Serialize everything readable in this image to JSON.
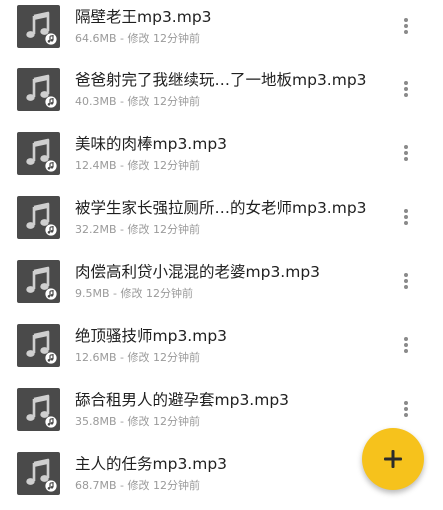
{
  "colors": {
    "thumb_bg": "#4a4a4a",
    "note_color": "#cfcfcf",
    "fab_bg": "#f6c21c",
    "title_color": "#1f1f1f",
    "meta_color": "#9a9a9a"
  },
  "icons": {
    "thumbnail": "music-note-icon",
    "badge": "audio-badge-icon",
    "row_menu": "more-vert-icon",
    "fab": "plus-icon"
  },
  "files": [
    {
      "name": "隔壁老王mp3.mp3",
      "size": "64.6MB",
      "modified": "修改 12分钟前"
    },
    {
      "name": "爸爸射完了我继续玩…了一地板mp3.mp3",
      "size": "40.3MB",
      "modified": "修改 12分钟前"
    },
    {
      "name": "美味的肉棒mp3.mp3",
      "size": "12.4MB",
      "modified": "修改 12分钟前"
    },
    {
      "name": "被学生家长强拉厕所…的女老师mp3.mp3",
      "size": "32.2MB",
      "modified": "修改 12分钟前"
    },
    {
      "name": "肉偿高利贷小混混的老婆mp3.mp3",
      "size": "9.5MB",
      "modified": "修改 12分钟前"
    },
    {
      "name": "绝顶骚技师mp3.mp3",
      "size": "12.6MB",
      "modified": "修改 12分钟前"
    },
    {
      "name": "舔合租男人的避孕套mp3.mp3",
      "size": "35.8MB",
      "modified": "修改 12分钟前"
    },
    {
      "name": "主人的任务mp3.mp3",
      "size": "68.7MB",
      "modified": "修改 12分钟前"
    }
  ],
  "meta_separator": " - ",
  "fab": {
    "label": "+"
  }
}
